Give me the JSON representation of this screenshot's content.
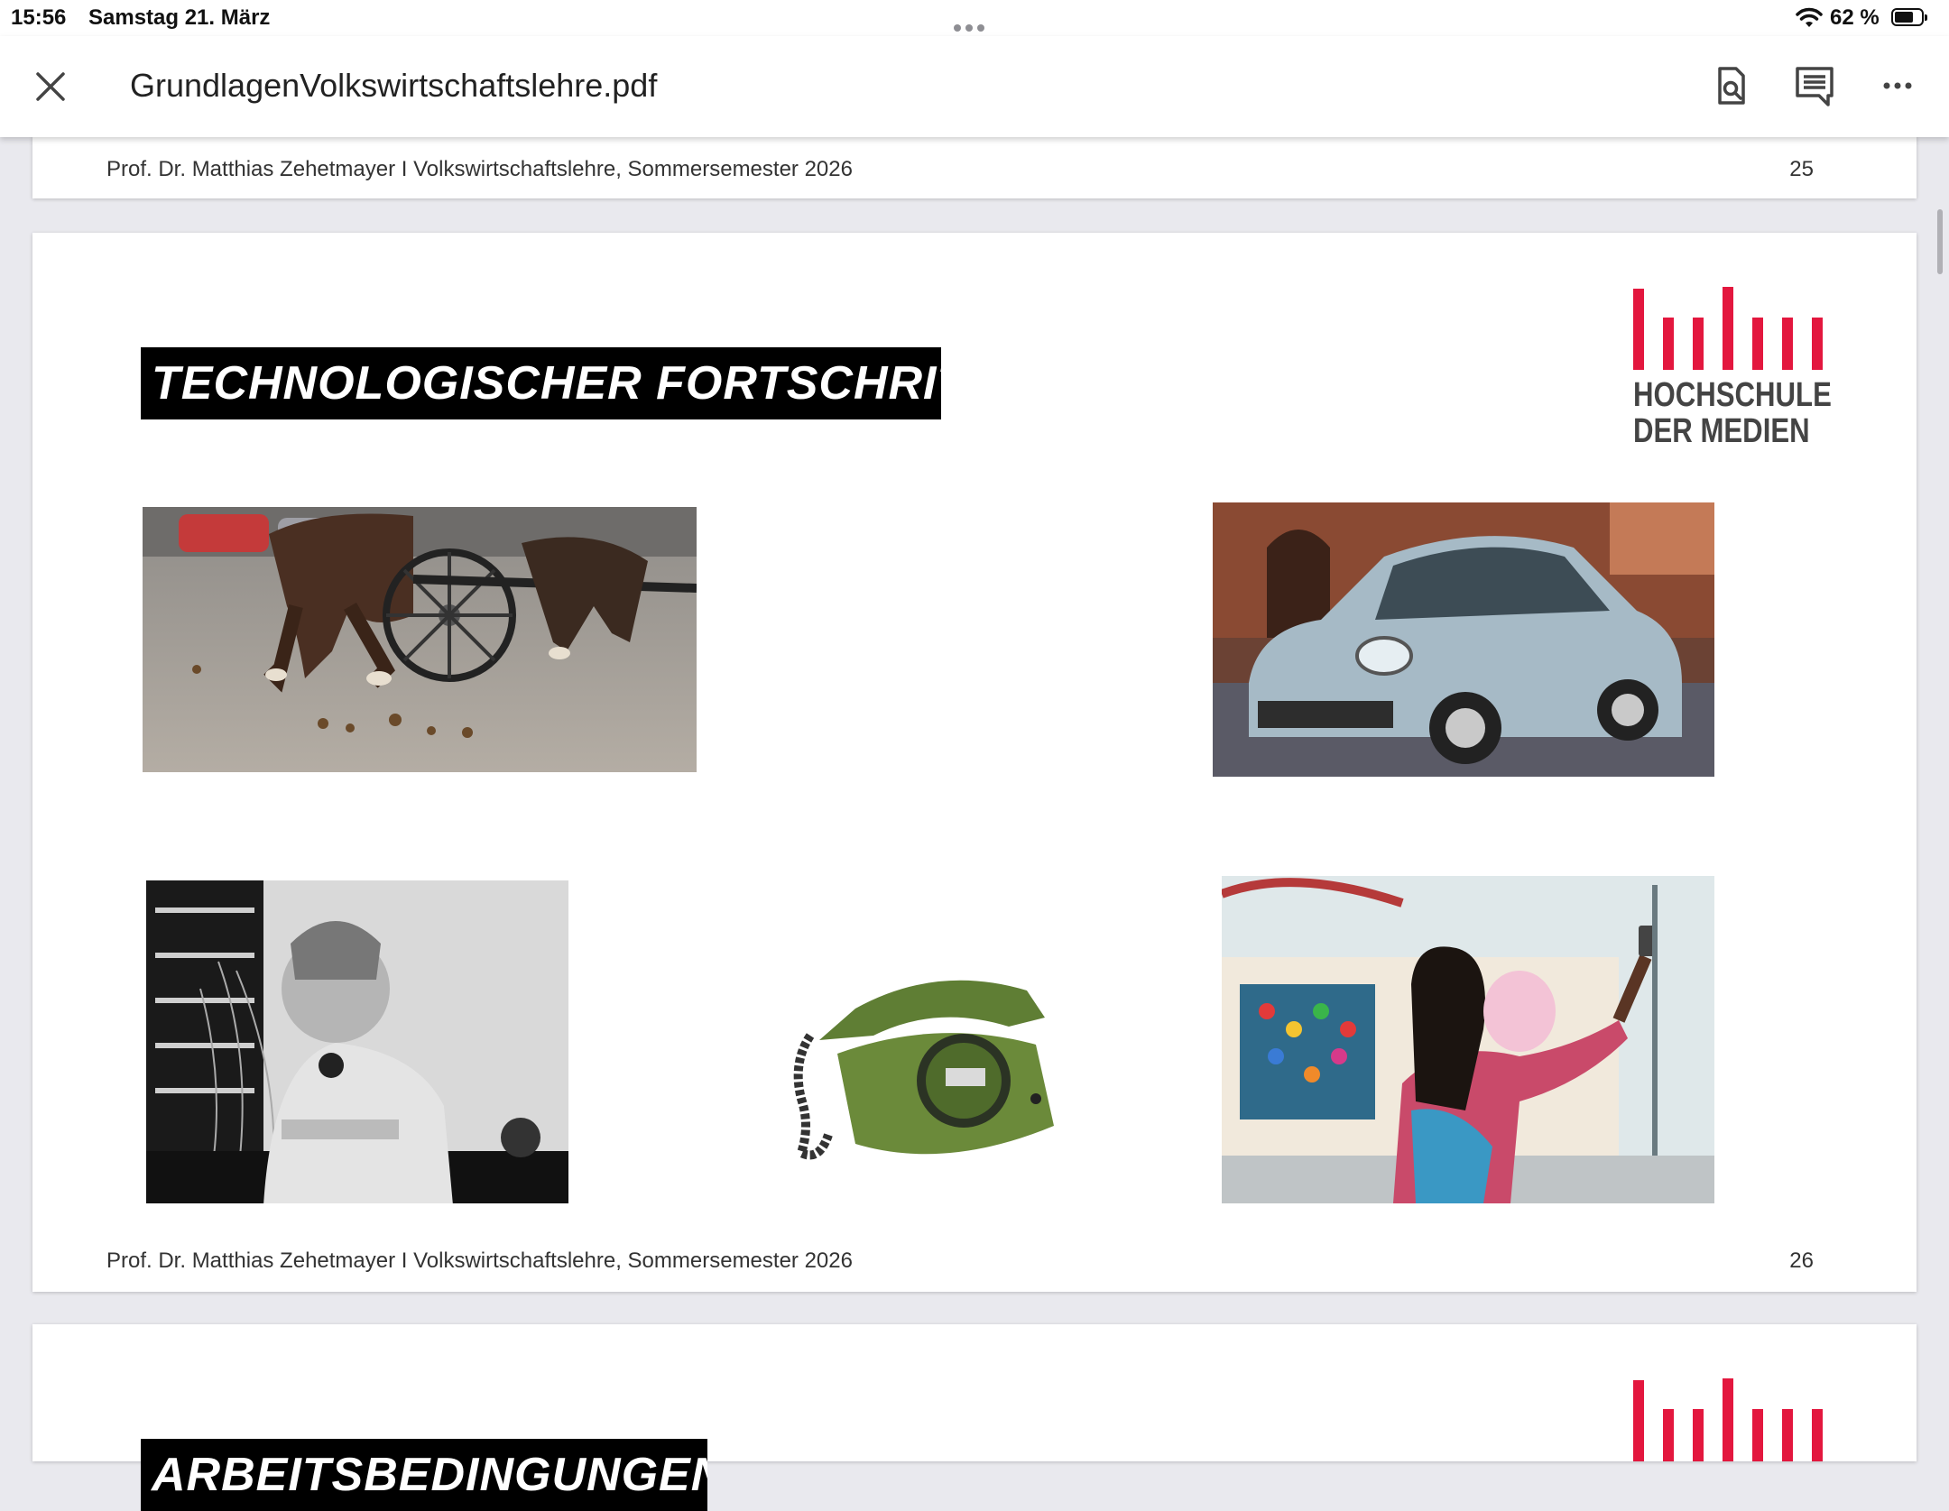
{
  "status_bar": {
    "time": "15:56",
    "date": "Samstag 21. März",
    "battery": "62 %",
    "battery_level_fraction": 0.62
  },
  "app_bar": {
    "filename": "GrundlagenVolkswirtschaftslehre.pdf",
    "icons": [
      "close-icon",
      "find-in-page-icon",
      "comments-icon",
      "more-icon"
    ]
  },
  "pages": [
    {
      "footer": "Prof. Dr. Matthias Zehetmayer I Volkswirtschaftslehre, Sommersemester 2026",
      "page_number": "25"
    },
    {
      "title": "TECHNOLOGISCHER FORTSCHRITT",
      "logo_line1": "HOCHSCHULE",
      "logo_line2": "DER MEDIEN",
      "images": [
        "horse-carriage-photo",
        "fiat-500-car-photo",
        "switchboard-operator-photo",
        "green-rotary-telephone-photo",
        "selfie-smartphone-photo"
      ],
      "footer": "Prof. Dr. Matthias Zehetmayer I Volkswirtschaftslehre, Sommersemester 2026",
      "page_number": "26"
    },
    {
      "title_partial": "ARBEITSBEDINGUNGEN"
    }
  ],
  "colors": {
    "logo_red": "#e3173e",
    "background": "#e9e9ee",
    "phone_green": "#6b8a3a"
  }
}
